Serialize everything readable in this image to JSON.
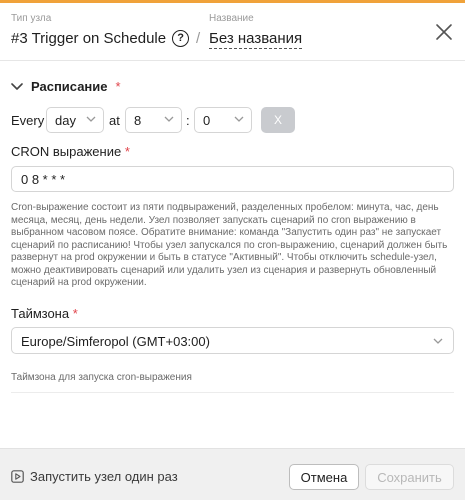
{
  "header": {
    "type_label": "Тип узла",
    "type_title": "#3 Trigger on Schedule",
    "name_label": "Название",
    "name_separator": "/",
    "name_value": "Без названия"
  },
  "schedule": {
    "section_title": "Расписание",
    "required_mark": "*",
    "every_label": "Every",
    "period_value": "day",
    "at_label": "at",
    "hour_value": "8",
    "time_separator": ":",
    "minute_value": "0",
    "clear_label": "X"
  },
  "cron": {
    "label": "CRON выражение",
    "required_mark": "*",
    "value": "0 8 * * *",
    "help": "Cron-выражение состоит из пяти подвыражений, разделенных пробелом: минута, час, день месяца, месяц, день недели. Узел позволяет запускать сценарий по cron выражению в выбранном часовом поясе. Обратите внимание: команда \"Запустить один раз\" не запускает сценарий по расписанию! Чтобы узел запускался по cron-выражению, сценарий должен быть развернут на prod окружении и быть в статусе \"Активный\". Чтобы отключить schedule-узел, можно деактивировать сценарий или удалить узел из сценария и развернуть обновленный сценарий на prod окружении."
  },
  "timezone": {
    "label": "Таймзона",
    "required_mark": "*",
    "value": "Europe/Simferopol (GMT+03:00)",
    "help": "Таймзона для запуска cron-выражения"
  },
  "footer": {
    "run_once_label": "Запустить узел один раз",
    "cancel_label": "Отмена",
    "save_label": "Сохранить"
  },
  "colors": {
    "accent": "#f0a23a",
    "required": "#e0434a",
    "clear_button": "#c9cbcf"
  }
}
